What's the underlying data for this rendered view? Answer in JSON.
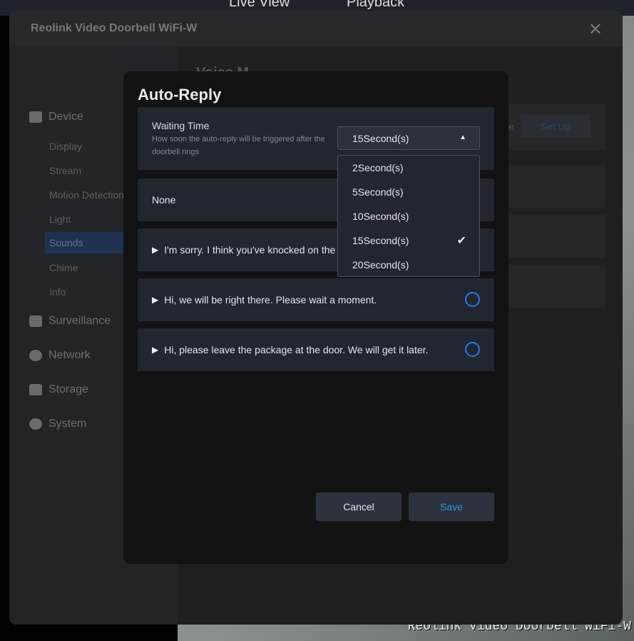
{
  "topbar": {
    "tabs": [
      {
        "label": "Live View",
        "active": true
      },
      {
        "label": "Playback",
        "active": false
      }
    ]
  },
  "video": {
    "osd": "Reolink Video Doorbell WiFi-W"
  },
  "window": {
    "title": "Reolink Video Doorbell WiFi-W",
    "close_icon": "x"
  },
  "sidebar": {
    "sections": [
      {
        "label": "Device",
        "icon": "camera-icon"
      },
      {
        "label": "Surveillance",
        "icon": "monitor-icon"
      },
      {
        "label": "Network",
        "icon": "globe-icon"
      },
      {
        "label": "Storage",
        "icon": "disk-icon"
      },
      {
        "label": "System",
        "icon": "gear-icon"
      }
    ],
    "device_items": [
      "Display",
      "Stream",
      "Motion Detection",
      "Light",
      "Sounds",
      "Chime",
      "Info"
    ],
    "selected": "Sounds"
  },
  "background": {
    "heading": "Voice M",
    "partial": "e",
    "setup": "Set Up"
  },
  "modal": {
    "title": "Auto-Reply",
    "waiting": {
      "label": "Waiting Time",
      "description": "How soon the auto-reply will be triggered after the doorbell rings",
      "value": "15Second(s)",
      "options": [
        "2Second(s)",
        "5Second(s)",
        "10Second(s)",
        "15Second(s)",
        "20Second(s)"
      ]
    },
    "replies": [
      {
        "label": "None"
      },
      {
        "label": "I'm sorry. I think you've knocked on the"
      },
      {
        "label": "Hi, we will be right there. Please wait a moment."
      },
      {
        "label": "Hi, please leave the package at the door. We will get it later."
      }
    ],
    "cancel": "Cancel",
    "save": "Save"
  },
  "colors": {
    "accent": "#1f78ff",
    "save_text": "#1e9be8"
  }
}
